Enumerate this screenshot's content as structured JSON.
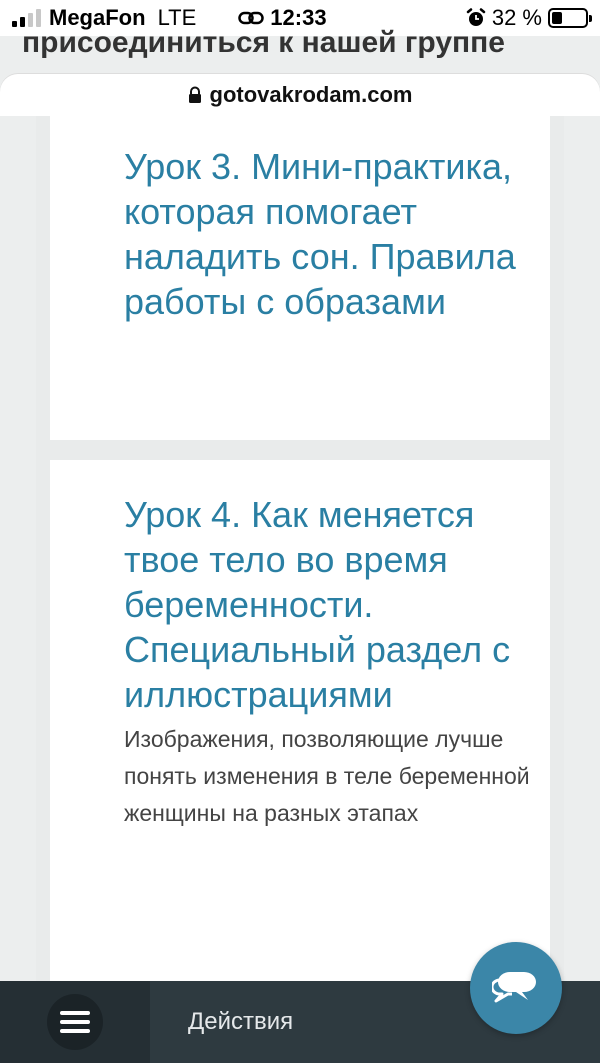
{
  "status_bar": {
    "carrier": "MegaFon",
    "network": "LTE",
    "time": "12:33",
    "battery_percent": "32 %",
    "battery_level": 0.32
  },
  "behind_page": {
    "title": "присоединиться к нашей группе"
  },
  "browser": {
    "url": "gotovakrodam.com"
  },
  "lessons": [
    {
      "title": "Урок 3. Мини-практика, которая помогает наладить сон. Правила работы с образами"
    },
    {
      "title": "Урок 4. Как меняется твое тело во время беременности. Специальный раздел с иллюстрациями",
      "description": "Изображения, позволяющие лучше понять изменения в теле беременной женщины на разных этапах"
    }
  ],
  "bottom_bar": {
    "actions_label": "Действия"
  },
  "colors": {
    "accent": "#2a7fa3",
    "toolbar": "#2e3a40",
    "chat_fab": "#3b86a8"
  },
  "icons": {
    "signal": "signal-icon",
    "link": "link-icon",
    "alarm": "alarm-icon",
    "battery": "battery-icon",
    "lock": "lock-icon",
    "menu": "hamburger-menu-icon",
    "chat": "chat-bubbles-icon"
  }
}
